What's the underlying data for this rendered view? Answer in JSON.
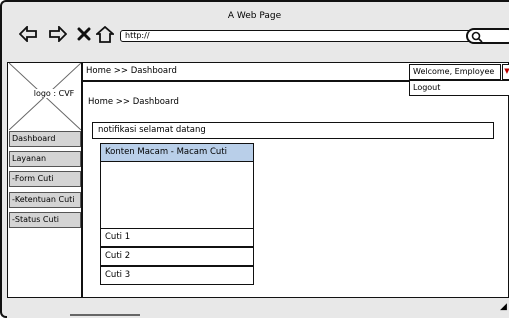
{
  "window": {
    "title": "A Web Page"
  },
  "nav": {
    "back_icon": "arrow-left-icon",
    "forward_icon": "arrow-right-icon",
    "close_icon": "close-icon",
    "home_icon": "home-icon"
  },
  "address_bar": {
    "value": "http://"
  },
  "logo": {
    "label": "logo : CVF"
  },
  "breadcrumb": {
    "top": "Home >> Dashboard",
    "main": "Home >> Dashboard"
  },
  "user_menu": {
    "welcome": "Welcome, Employee",
    "logout": "Logout"
  },
  "sidebar": {
    "items": [
      {
        "label": "Dashboard"
      },
      {
        "label": "Layanan"
      },
      {
        "label": "-Form Cuti"
      },
      {
        "label": "-Ketentuan Cuti"
      },
      {
        "label": "-Status Cuti"
      }
    ]
  },
  "notification": {
    "text": "notifikasi selamat datang"
  },
  "content_list": {
    "header": "Konten Macam - Macam Cuti",
    "items": [
      "Cuti 1",
      "Cuti 2",
      "Cuti 3"
    ]
  },
  "colors": {
    "list_header_bg": "#b9cfe9",
    "sidebar_item_bg": "#d4d4d4",
    "caret": "#b00000"
  }
}
